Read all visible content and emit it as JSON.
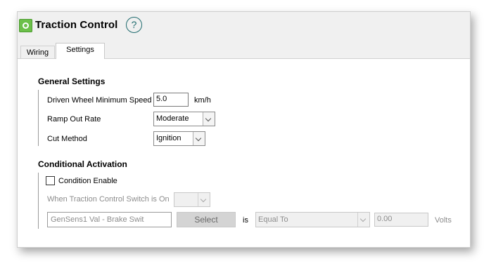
{
  "window": {
    "title": "Traction Control",
    "help_icon": "?"
  },
  "tabs": [
    {
      "label": "Wiring"
    },
    {
      "label": "Settings"
    }
  ],
  "general": {
    "heading": "General Settings",
    "min_speed_label": "Driven Wheel Minimum Speed",
    "min_speed_value": "5.0",
    "min_speed_unit": "km/h",
    "ramp_label": "Ramp Out Rate",
    "ramp_value": "Moderate",
    "cut_label": "Cut Method",
    "cut_value": "Ignition"
  },
  "conditional": {
    "heading": "Conditional Activation",
    "enable_label": "Condition Enable",
    "enable_checked": false,
    "switch_label": "When Traction Control Switch is On",
    "switch_value": "",
    "source_value": "GenSens1 Val - Brake Swit",
    "select_button": "Select",
    "is_label": "is",
    "operator_value": "Equal To",
    "threshold_value": "0.00",
    "unit_label": "Volts"
  },
  "colors": {
    "accent_icon": "#6cc04a",
    "help_icon": "#1f6b6e"
  }
}
